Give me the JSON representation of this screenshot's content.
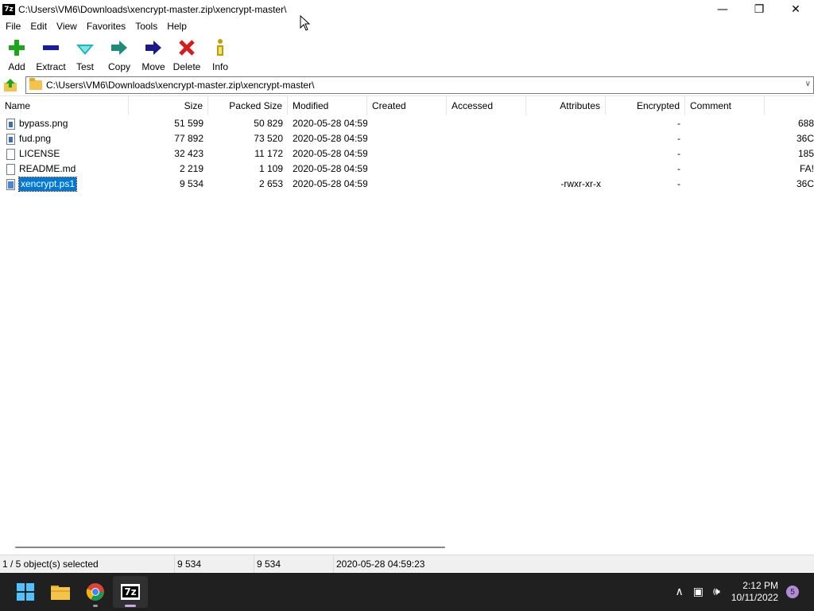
{
  "window": {
    "title": "C:\\Users\\VM6\\Downloads\\xencrypt-master.zip\\xencrypt-master\\",
    "app_icon_text": "7z",
    "minimize": "—",
    "maximize": "❐",
    "close": "✕"
  },
  "menu": [
    "File",
    "Edit",
    "View",
    "Favorites",
    "Tools",
    "Help"
  ],
  "toolbar": [
    {
      "label": "Add",
      "icon": "plus-icon",
      "color": "#1aa81a"
    },
    {
      "label": "Extract",
      "icon": "minus-icon",
      "color": "#1a1aa8"
    },
    {
      "label": "Test",
      "icon": "checkmark-icon",
      "color": "#19b8b8"
    },
    {
      "label": "Copy",
      "icon": "arrow-right-teal-icon",
      "color": "#1e8c78"
    },
    {
      "label": "Move",
      "icon": "arrow-right-blue-icon",
      "color": "#1a1a8c"
    },
    {
      "label": "Delete",
      "icon": "delete-x-icon",
      "color": "#d81c1c"
    },
    {
      "label": "Info",
      "icon": "info-icon",
      "color": "#c0a000"
    }
  ],
  "address": {
    "path": "C:\\Users\\VM6\\Downloads\\xencrypt-master.zip\\xencrypt-master\\"
  },
  "columns": [
    "Name",
    "Size",
    "Packed Size",
    "Modified",
    "Created",
    "Accessed",
    "Attributes",
    "Encrypted",
    "Comment",
    ""
  ],
  "files": [
    {
      "name": "bypass.png",
      "size": "51 599",
      "packed": "50 829",
      "modified": "2020-05-28 04:59",
      "created": "",
      "accessed": "",
      "attributes": "",
      "encrypted": "-",
      "comment": "",
      "extra": "688",
      "icon": "image-file-icon",
      "selected": false
    },
    {
      "name": "fud.png",
      "size": "77 892",
      "packed": "73 520",
      "modified": "2020-05-28 04:59",
      "created": "",
      "accessed": "",
      "attributes": "",
      "encrypted": "-",
      "comment": "",
      "extra": "36C",
      "icon": "image-file-icon",
      "selected": false
    },
    {
      "name": "LICENSE",
      "size": "32 423",
      "packed": "11 172",
      "modified": "2020-05-28 04:59",
      "created": "",
      "accessed": "",
      "attributes": "",
      "encrypted": "-",
      "comment": "",
      "extra": "185",
      "icon": "document-file-icon",
      "selected": false
    },
    {
      "name": "README.md",
      "size": "2 219",
      "packed": "1 109",
      "modified": "2020-05-28 04:59",
      "created": "",
      "accessed": "",
      "attributes": "",
      "encrypted": "-",
      "comment": "",
      "extra": "FA!",
      "icon": "document-file-icon",
      "selected": false
    },
    {
      "name": "xencrypt.ps1",
      "size": "9 534",
      "packed": "2 653",
      "modified": "2020-05-28 04:59",
      "created": "",
      "accessed": "",
      "attributes": "-rwxr-xr-x",
      "encrypted": "-",
      "comment": "",
      "extra": "36C",
      "icon": "powershell-file-icon",
      "selected": true
    }
  ],
  "status": {
    "selected": "1 / 5 object(s) selected",
    "size": "9 534",
    "packed": "9 534",
    "modified": "2020-05-28 04:59:23"
  },
  "taskbar": {
    "apps": [
      "windows-start-icon",
      "file-explorer-icon",
      "chrome-icon",
      "7zip-icon"
    ],
    "sevenzip_text": "7z",
    "clock_time": "2:12 PM",
    "clock_date": "10/11/2022",
    "notification_count": "5"
  },
  "colors": {
    "selection": "#0078d7",
    "taskbar_bg": "#202020",
    "accent": "#4cc2ff"
  }
}
